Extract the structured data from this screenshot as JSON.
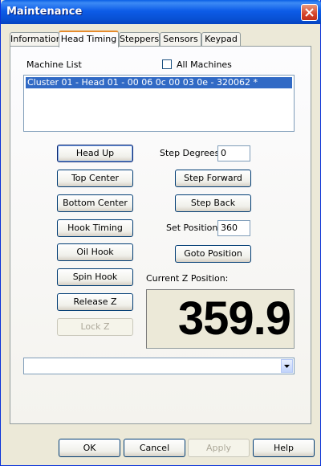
{
  "window": {
    "title": "Maintenance"
  },
  "tabs": [
    {
      "label": "Information",
      "active": false
    },
    {
      "label": "Head Timing",
      "active": true
    },
    {
      "label": "Steppers",
      "active": false
    },
    {
      "label": "Sensors",
      "active": false
    },
    {
      "label": "Keypad",
      "active": false
    }
  ],
  "machine_list": {
    "label": "Machine List",
    "all_machines_label": "All Machines",
    "all_machines_checked": false,
    "items": [
      {
        "text": "Cluster 01 - Head 01 - 00 06 0c 00 03 0e - 320062 *",
        "selected": true
      }
    ]
  },
  "left_buttons": {
    "head_up": "Head Up",
    "top_center": "Top Center",
    "bottom_center": "Bottom Center",
    "hook_timing": "Hook Timing",
    "oil_hook": "Oil Hook",
    "spin_hook": "Spin Hook",
    "release_z": "Release Z",
    "lock_z": "Lock Z"
  },
  "step": {
    "degrees_label": "Step Degrees:",
    "degrees_value": "0",
    "forward": "Step Forward",
    "back": "Step Back"
  },
  "set_position": {
    "label": "Set Position:",
    "value": "360",
    "goto": "Goto Position"
  },
  "z_position": {
    "label": "Current Z Position:",
    "value": "359.9"
  },
  "dropdown": {
    "selected": ""
  },
  "footer": {
    "ok": "OK",
    "cancel": "Cancel",
    "apply": "Apply",
    "help": "Help"
  },
  "colors": {
    "titlebar": "#0a5fe5",
    "selection": "#316ac5",
    "active_tab_accent": "#e68b2c"
  }
}
